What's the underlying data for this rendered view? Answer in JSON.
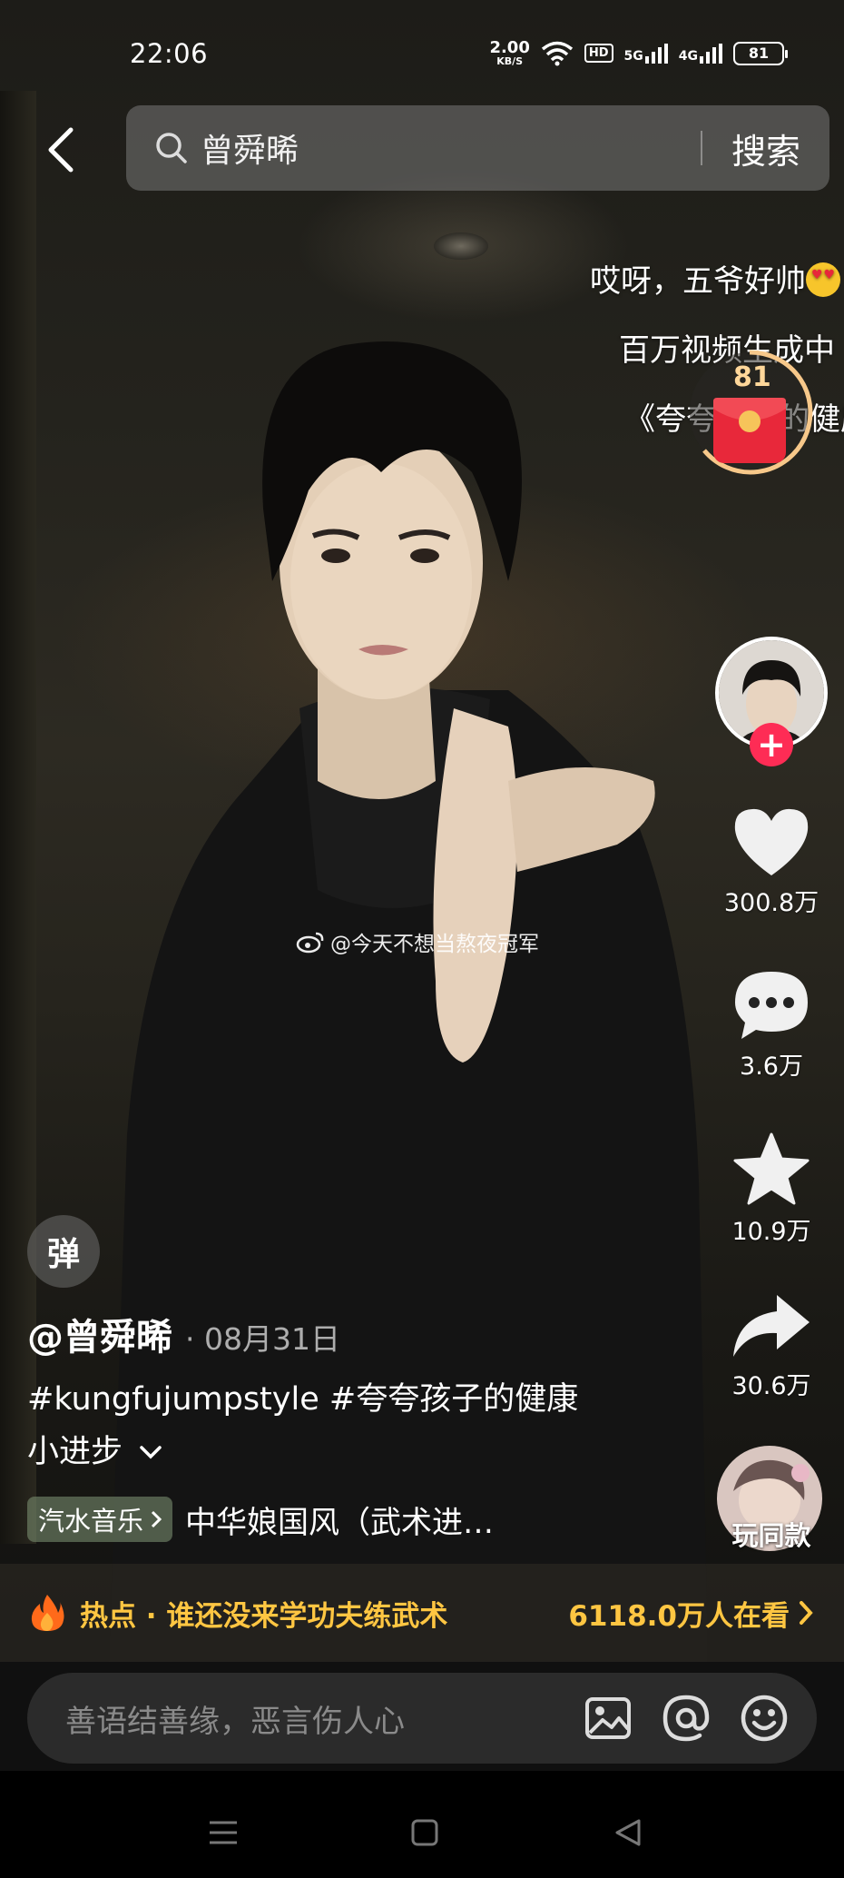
{
  "status": {
    "time": "22:06",
    "net_speed_value": "2.00",
    "net_speed_unit": "KB/S",
    "hd_label": "HD",
    "net1": "5G",
    "net2": "4G",
    "battery": "81"
  },
  "search": {
    "query": "曾舜晞",
    "submit_label": "搜索"
  },
  "danmu": [
    "哎呀，五爷好帅",
    "百万视频生成中",
    "《夸夸孩子的健康"
  ],
  "red_packet": {
    "count": "81"
  },
  "watermark": "@今天不想当熬夜冠军",
  "actions": {
    "likes": "300.8万",
    "comments": "3.6万",
    "favorites": "10.9万",
    "shares": "30.6万",
    "same_style": "玩同款"
  },
  "danmu_toggle": "弹",
  "video": {
    "author": "@曾舜晞",
    "date": "· 08月31日",
    "caption_line1": "#kungfujumpstyle #夸夸孩子的健康",
    "caption_line2": "小进步",
    "music_tag": "汽水音乐",
    "music_title": "中华娘国风（武术进…"
  },
  "hot": {
    "text": "热点 · 谁还没来学功夫练武术",
    "viewers": "6118.0万人在看"
  },
  "comment_box": {
    "placeholder": "善语结善缘，恶言伤人心"
  },
  "colors": {
    "accent_pink": "#fe2c55",
    "hot_yellow": "#ffc642"
  }
}
